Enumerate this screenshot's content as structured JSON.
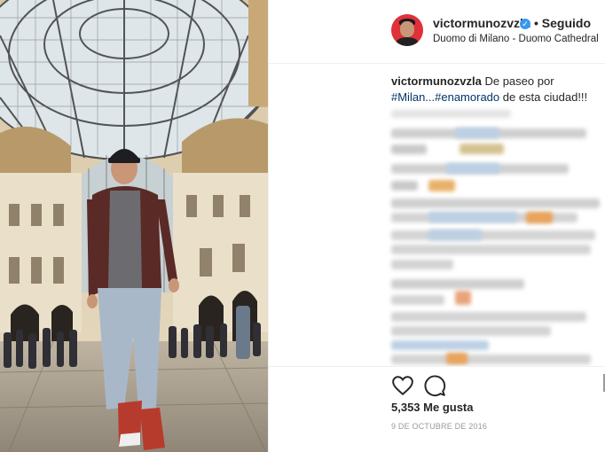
{
  "post": {
    "username": "victormunozvzla",
    "verified_mark": "✓",
    "follow_status": "• Seguido",
    "location": "Duomo di Milano - Duomo Cathedral",
    "caption": {
      "username": "victormunozvzla",
      "text_before": " De paseo por ",
      "hashtags": "#Milan...#enamorado",
      "text_after": " de esta ciudad!!!"
    },
    "likes": "5,353 Me gusta",
    "date": "9 DE OCTUBRE DE 2016"
  },
  "icons": {
    "verified": "verified-badge-icon",
    "like": "heart-icon",
    "comment": "comment-icon"
  },
  "colors": {
    "link": "#003569",
    "verified": "#3897f0",
    "muted": "#999999",
    "avatar_bg": "#e0303a"
  }
}
